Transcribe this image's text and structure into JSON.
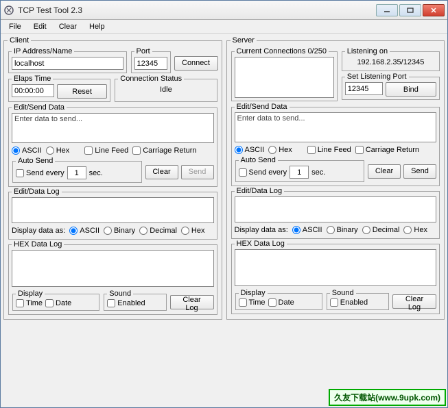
{
  "title": "TCP Test Tool 2.3",
  "menu": {
    "file": "File",
    "edit": "Edit",
    "clear": "Clear",
    "help": "Help"
  },
  "client": {
    "legend": "Client",
    "ip_legend": "IP Address/Name",
    "ip_value": "localhost",
    "port_legend": "Port",
    "port_value": "12345",
    "connect_btn": "Connect",
    "elaps_legend": "Elaps Time",
    "elaps_value": "00:00:00",
    "reset_btn": "Reset",
    "connstat_legend": "Connection Status",
    "connstat_value": "Idle",
    "editsend_legend": "Edit/Send Data",
    "send_placeholder": "Enter data to send...",
    "ascii": "ASCII",
    "hex": "Hex",
    "linefeed": "Line Feed",
    "cr": "Carriage Return",
    "autosend_legend": "Auto Send",
    "sendevery": "Send every",
    "interval": "1",
    "sec": "sec.",
    "clear_btn": "Clear",
    "send_btn": "Send",
    "datalog_legend": "Edit/Data Log",
    "displayas": "Display data as:",
    "binary": "Binary",
    "decimal": "Decimal",
    "hexlog_legend": "HEX Data Log",
    "display_legend": "Display",
    "time": "Time",
    "date": "Date",
    "sound_legend": "Sound",
    "enabled": "Enabled",
    "clearlog_btn": "Clear Log"
  },
  "server": {
    "legend": "Server",
    "curconn_legend": "Current Connections 0/250",
    "listen_legend": "Listening on",
    "listen_value": "192.168.2.35/12345",
    "setport_legend": "Set Listening Port",
    "setport_value": "12345",
    "bind_btn": "Bind",
    "editsend_legend": "Edit/Send Data",
    "send_placeholder": "Enter data to send...",
    "ascii": "ASCII",
    "hex": "Hex",
    "linefeed": "Line Feed",
    "cr": "Carriage Return",
    "autosend_legend": "Auto Send",
    "sendevery": "Send every",
    "interval": "1",
    "sec": "sec.",
    "clear_btn": "Clear",
    "send_btn": "Send",
    "datalog_legend": "Edit/Data Log",
    "displayas": "Display data as:",
    "binary": "Binary",
    "decimal": "Decimal",
    "hexlog_legend": "HEX Data Log",
    "display_legend": "Display",
    "time": "Time",
    "date": "Date",
    "sound_legend": "Sound",
    "enabled": "Enabled",
    "clearlog_btn": "Clear Log"
  },
  "watermark": "久友下载站(www.9upk.com)"
}
